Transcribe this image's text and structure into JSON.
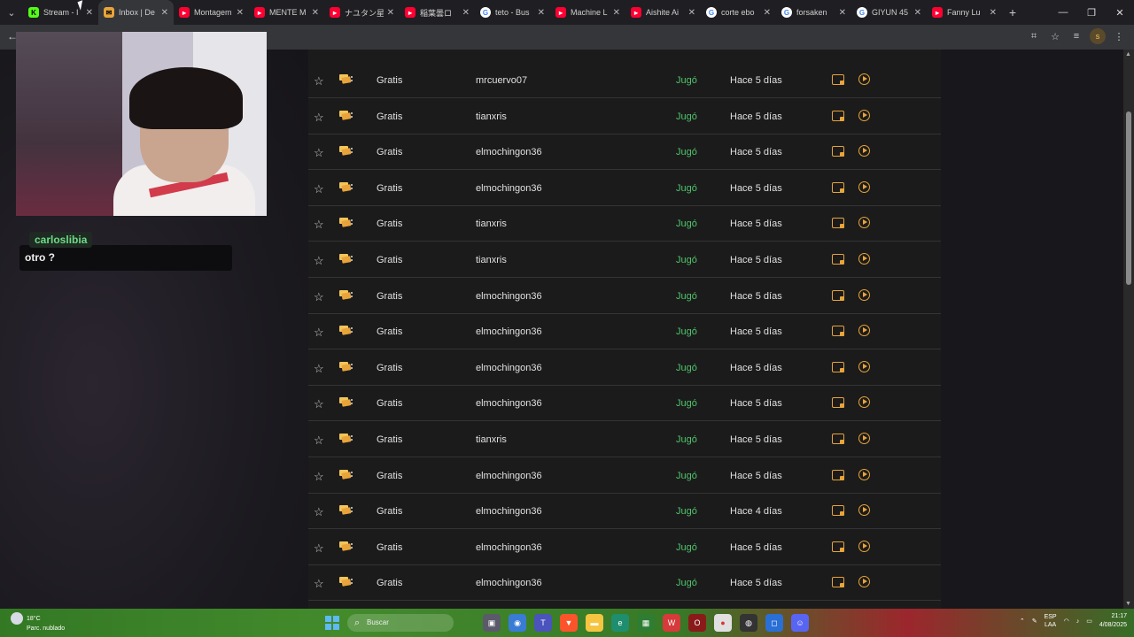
{
  "browser": {
    "tabs": [
      {
        "title": "Stream - I",
        "icon": "kick-icon",
        "color": "#53fc18",
        "active": false
      },
      {
        "title": "Inbox | De",
        "icon": "inbox-icon",
        "color": "#e8a43a",
        "active": true
      },
      {
        "title": "Montagem",
        "icon": "youtube-icon",
        "color": "#ff0033",
        "active": false
      },
      {
        "title": "MENTE M",
        "icon": "youtube-icon",
        "color": "#ff0033",
        "active": false
      },
      {
        "title": "ナユタン星",
        "icon": "youtube-icon",
        "color": "#ff0033",
        "active": false
      },
      {
        "title": "稲葉曇ロ",
        "icon": "youtube-icon",
        "color": "#ff0033",
        "active": false
      },
      {
        "title": "teto - Bus",
        "icon": "google-icon",
        "color": "#ffffff",
        "active": false
      },
      {
        "title": "Machine L",
        "icon": "youtube-icon",
        "color": "#ff0033",
        "active": false
      },
      {
        "title": "Aishite Ai",
        "icon": "youtube-icon",
        "color": "#ff0033",
        "active": false
      },
      {
        "title": "corte ebo",
        "icon": "google-icon",
        "color": "#ffffff",
        "active": false
      },
      {
        "title": "forsaken",
        "icon": "google-icon",
        "color": "#ffffff",
        "active": false
      },
      {
        "title": "GIYUN 45",
        "icon": "google-icon",
        "color": "#ffffff",
        "active": false
      },
      {
        "title": "Fanny Lu",
        "icon": "youtube-icon",
        "color": "#ff0033",
        "active": false
      }
    ],
    "new_tab": "+",
    "profile_initial": "s"
  },
  "games_table": {
    "rows": [
      {
        "mode": "Gratis",
        "user": "mrcuervo07",
        "status": "Jugó",
        "when": "Hace 5 días"
      },
      {
        "mode": "Gratis",
        "user": "tianxris",
        "status": "Jugó",
        "when": "Hace 5 días"
      },
      {
        "mode": "Gratis",
        "user": "elmochingon36",
        "status": "Jugó",
        "when": "Hace 5 días"
      },
      {
        "mode": "Gratis",
        "user": "elmochingon36",
        "status": "Jugó",
        "when": "Hace 5 días"
      },
      {
        "mode": "Gratis",
        "user": "tianxris",
        "status": "Jugó",
        "when": "Hace 5 días"
      },
      {
        "mode": "Gratis",
        "user": "tianxris",
        "status": "Jugó",
        "when": "Hace 5 días"
      },
      {
        "mode": "Gratis",
        "user": "elmochingon36",
        "status": "Jugó",
        "when": "Hace 5 días"
      },
      {
        "mode": "Gratis",
        "user": "elmochingon36",
        "status": "Jugó",
        "when": "Hace 5 días"
      },
      {
        "mode": "Gratis",
        "user": "elmochingon36",
        "status": "Jugó",
        "when": "Hace 5 días"
      },
      {
        "mode": "Gratis",
        "user": "elmochingon36",
        "status": "Jugó",
        "when": "Hace 5 días"
      },
      {
        "mode": "Gratis",
        "user": "tianxris",
        "status": "Jugó",
        "when": "Hace 5 días"
      },
      {
        "mode": "Gratis",
        "user": "elmochingon36",
        "status": "Jugó",
        "when": "Hace 5 días"
      },
      {
        "mode": "Gratis",
        "user": "elmochingon36",
        "status": "Jugó",
        "when": "Hace 4 días"
      },
      {
        "mode": "Gratis",
        "user": "elmochingon36",
        "status": "Jugó",
        "when": "Hace 5 días"
      },
      {
        "mode": "Gratis",
        "user": "elmochingon36",
        "status": "Jugó",
        "when": "Hace 5 días"
      }
    ],
    "status_color": "#4fc46b",
    "accent_color": "#e8a43a"
  },
  "chat": {
    "username": "carloslibia",
    "message": "otro ?"
  },
  "taskbar": {
    "temperature": "18°C",
    "weather": "Parc. nublado",
    "search_placeholder": "Buscar",
    "lang_top": "ESP",
    "lang_bottom": "LAA",
    "time": "21:17",
    "date": "4/08/2025"
  }
}
